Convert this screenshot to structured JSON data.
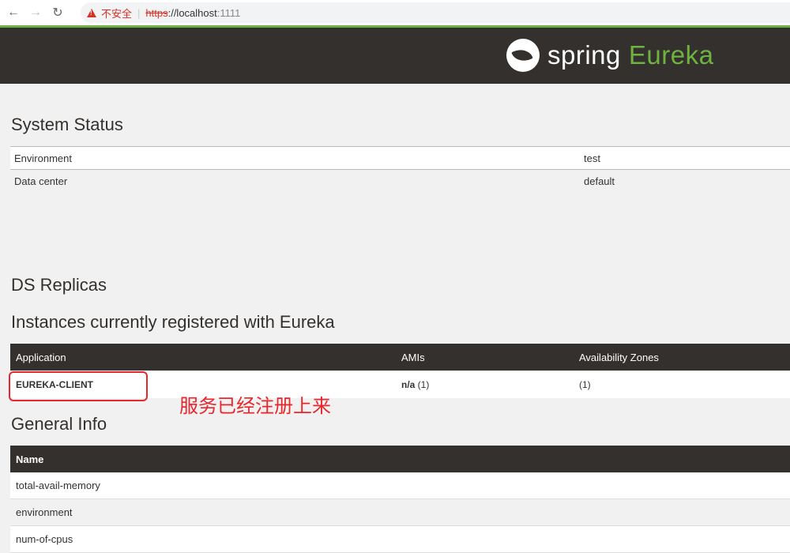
{
  "browser": {
    "back_icon": "←",
    "forward_icon": "→",
    "reload_icon": "↻",
    "security_label": "不安全",
    "separator": "|",
    "url_scheme": "https",
    "url_rest": "://localhost",
    "url_port": ":1111"
  },
  "header": {
    "logo_word": "spring",
    "logo_product": "Eureka",
    "brand_green": "#6db33f",
    "header_bg": "#34302d"
  },
  "system_status": {
    "title": "System Status",
    "rows": [
      {
        "key": "Environment",
        "value": "test"
      },
      {
        "key": "Data center",
        "value": "default"
      }
    ]
  },
  "ds_replicas": {
    "title": "DS Replicas"
  },
  "instances": {
    "title": "Instances currently registered with Eureka",
    "columns": [
      "Application",
      "AMIs",
      "Availability Zones"
    ],
    "rows": [
      {
        "application": "EUREKA-CLIENT",
        "amis_bold": "n/a",
        "amis_count": " (1)",
        "zones": "(1)"
      }
    ]
  },
  "annotation": {
    "text": "服务已经注册上来",
    "color": "#e8262b"
  },
  "general_info": {
    "title": "General Info",
    "column": "Name",
    "rows": [
      "total-avail-memory",
      "environment",
      "num-of-cpus"
    ]
  }
}
